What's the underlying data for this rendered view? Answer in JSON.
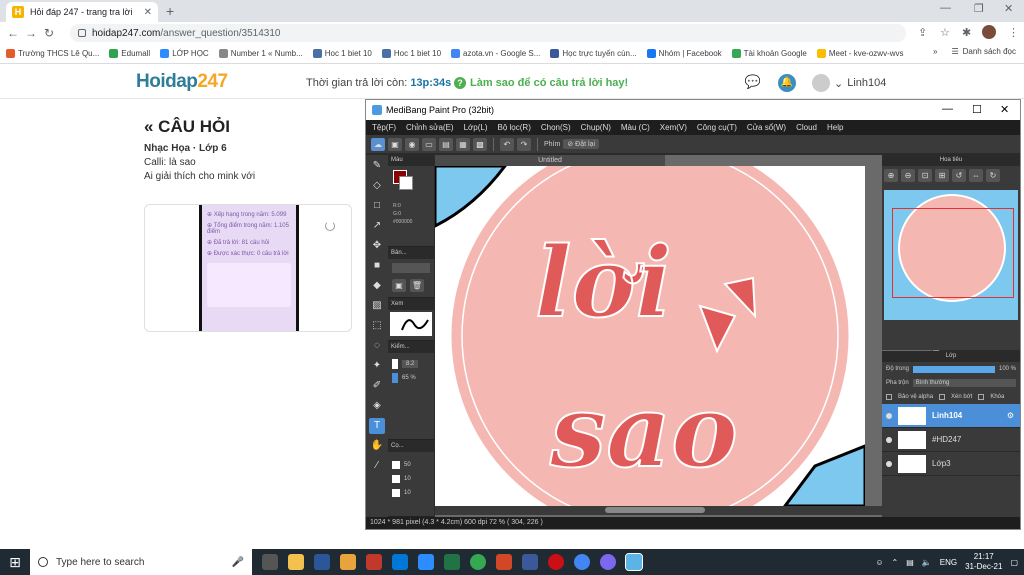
{
  "browser": {
    "tab_title": "Hỏi đáp 247 - trang tra lời",
    "url_host": "hoidap247.com",
    "url_path": "/answer_question/3514310",
    "bookmarks": [
      {
        "label": "Trường THCS Lê Qu...",
        "color": "#e25c2c"
      },
      {
        "label": "Edumall",
        "color": "#2ea44f"
      },
      {
        "label": "LỚP HỌC",
        "color": "#2d8cff"
      },
      {
        "label": "Number 1 « Numb...",
        "color": "#888888"
      },
      {
        "label": "Hoc 1 biet 10",
        "color": "#4a6fa5"
      },
      {
        "label": "Hoc 1 biet 10",
        "color": "#4a6fa5"
      },
      {
        "label": "azota.vn - Google S...",
        "color": "#4285f4"
      },
      {
        "label": "Học trực tuyến cùn...",
        "color": "#3b5998"
      },
      {
        "label": "Nhóm | Facebook",
        "color": "#1877f2"
      },
      {
        "label": "Tài khoản Google",
        "color": "#34a853"
      },
      {
        "label": "Meet - kve-ozwv-wvs",
        "color": "#fbbc04"
      }
    ],
    "bookmarks_more": "»",
    "reading_list": "Danh sách đọc"
  },
  "site": {
    "logo_main": "Hoidap",
    "logo_num": "247",
    "time_label": "Thời gian trả lời còn: ",
    "time_value": "13p:34s",
    "hint": "Làm sao để có câu trả lời hay!",
    "username": "Linh104"
  },
  "question": {
    "heading": "« CÂU HỎI",
    "meta": "Nhạc Họa · Lớp 6",
    "lines": [
      "Calli: là sao",
      "Ai giải thích cho mink với"
    ],
    "image_lines": [
      "⊕ Xếp hạng trong năm: 5.099",
      "⊕ Tổng điểm trong năm: 1.105 điểm",
      "⊕ Đã trả lời: 81 câu hỏi",
      "⊕ Được xác thực: 0 câu trả lời"
    ]
  },
  "medibang": {
    "title": "MediBang Paint Pro (32bit)",
    "menu": [
      "Tệp(F)",
      "Chỉnh sửa(E)",
      "Lớp(L)",
      "Bộ lọc(R)",
      "Chọn(S)",
      "Chụp(N)",
      "Màu (C)",
      "Xem(V)",
      "Công cụ(T)",
      "Cửa sổ(W)",
      "Cloud",
      "Help"
    ],
    "toolbar_phim": "Phím",
    "toolbar_reset": "Đặt lại",
    "doc_tab": "Untitled",
    "panel_color": "Màu",
    "color_r": "R:0",
    "color_g": "G:0",
    "color_hex": "#000000",
    "panel_brush": "Bản...",
    "panel_view": "Xem",
    "panel_check": "Kiểm...",
    "size_value": "8.2",
    "opacity_value": "65 %",
    "panel_size": "Cọ...",
    "size_list": [
      "50",
      "10",
      "10"
    ],
    "navigator": "Hoa tiêu",
    "layer_panel": "Lớp",
    "opacity_label": "Độ trong",
    "opacity_pct": "100 %",
    "blend_label": "Pha trộn",
    "blend_value": "Bình thường",
    "protect_alpha": "Bảo vệ alpha",
    "clipping": "Xén bớt",
    "lock": "Khóa",
    "layers": [
      {
        "name": "Linh104",
        "selected": true
      },
      {
        "name": "#HD247",
        "selected": false
      },
      {
        "name": "Lớp3",
        "selected": false
      }
    ],
    "canvas_text_1": "lời",
    "canvas_text_2": "sao",
    "status": "1024 * 981 pixel   (4.3 * 4.2cm)   600 dpi   72 %   ( 304, 226 )"
  },
  "taskbar": {
    "search_placeholder": "Type here to search",
    "lang": "ENG",
    "time": "21:17",
    "date": "31-Dec-21"
  }
}
